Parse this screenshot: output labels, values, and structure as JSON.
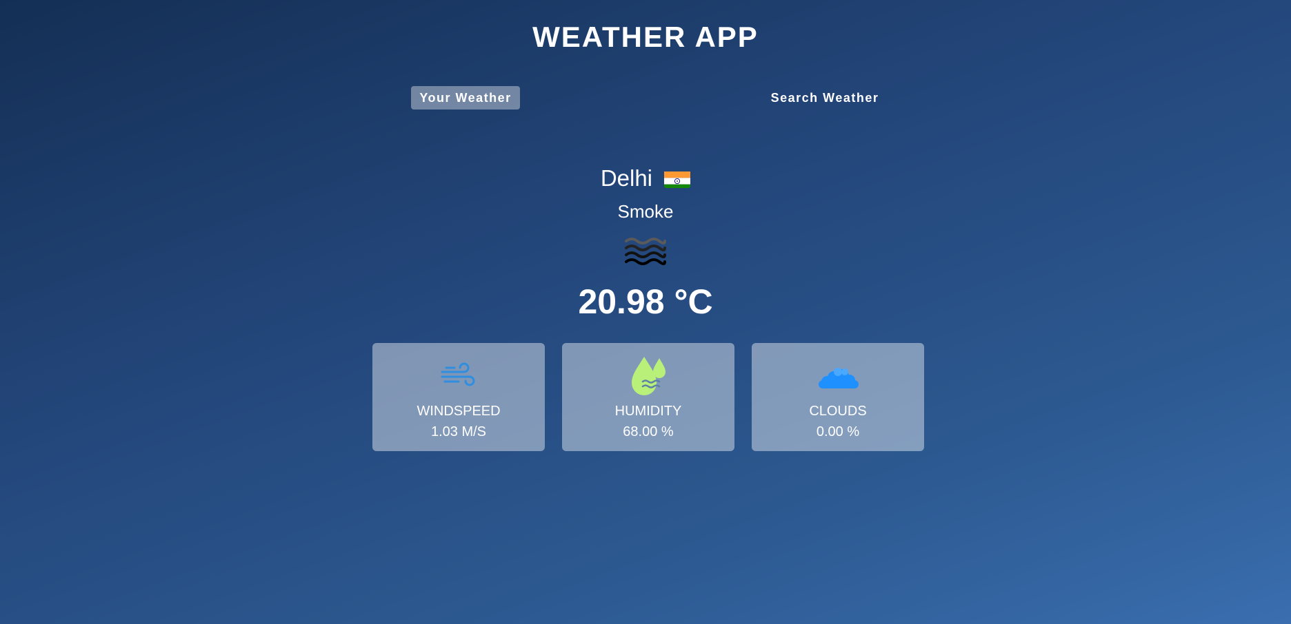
{
  "app": {
    "title": "WEATHER APP"
  },
  "tabs": [
    {
      "label": "Your Weather",
      "active": true
    },
    {
      "label": "Search Weather",
      "active": false
    }
  ],
  "weather": {
    "city": "Delhi",
    "country_flag": "India flag",
    "description": "Smoke",
    "icon": "smoke-haze-icon",
    "temperature": "20.98 °C"
  },
  "cards": [
    {
      "icon": "wind-icon",
      "label": "WINDSPEED",
      "value": "1.03 M/S"
    },
    {
      "icon": "humidity-drops-icon",
      "label": "HUMIDITY",
      "value": "68.00 %"
    },
    {
      "icon": "clouds-icon",
      "label": "CLOUDS",
      "value": "0.00 %"
    }
  ],
  "colors": {
    "background_top": "#142f55",
    "background_bottom": "#3a6eaf",
    "card_bg": "rgba(255,255,255,0.42)",
    "wind_icon": "#2f8ee0",
    "humidity_icon": "#b8f07a",
    "clouds_icon": "#1e90ff"
  }
}
